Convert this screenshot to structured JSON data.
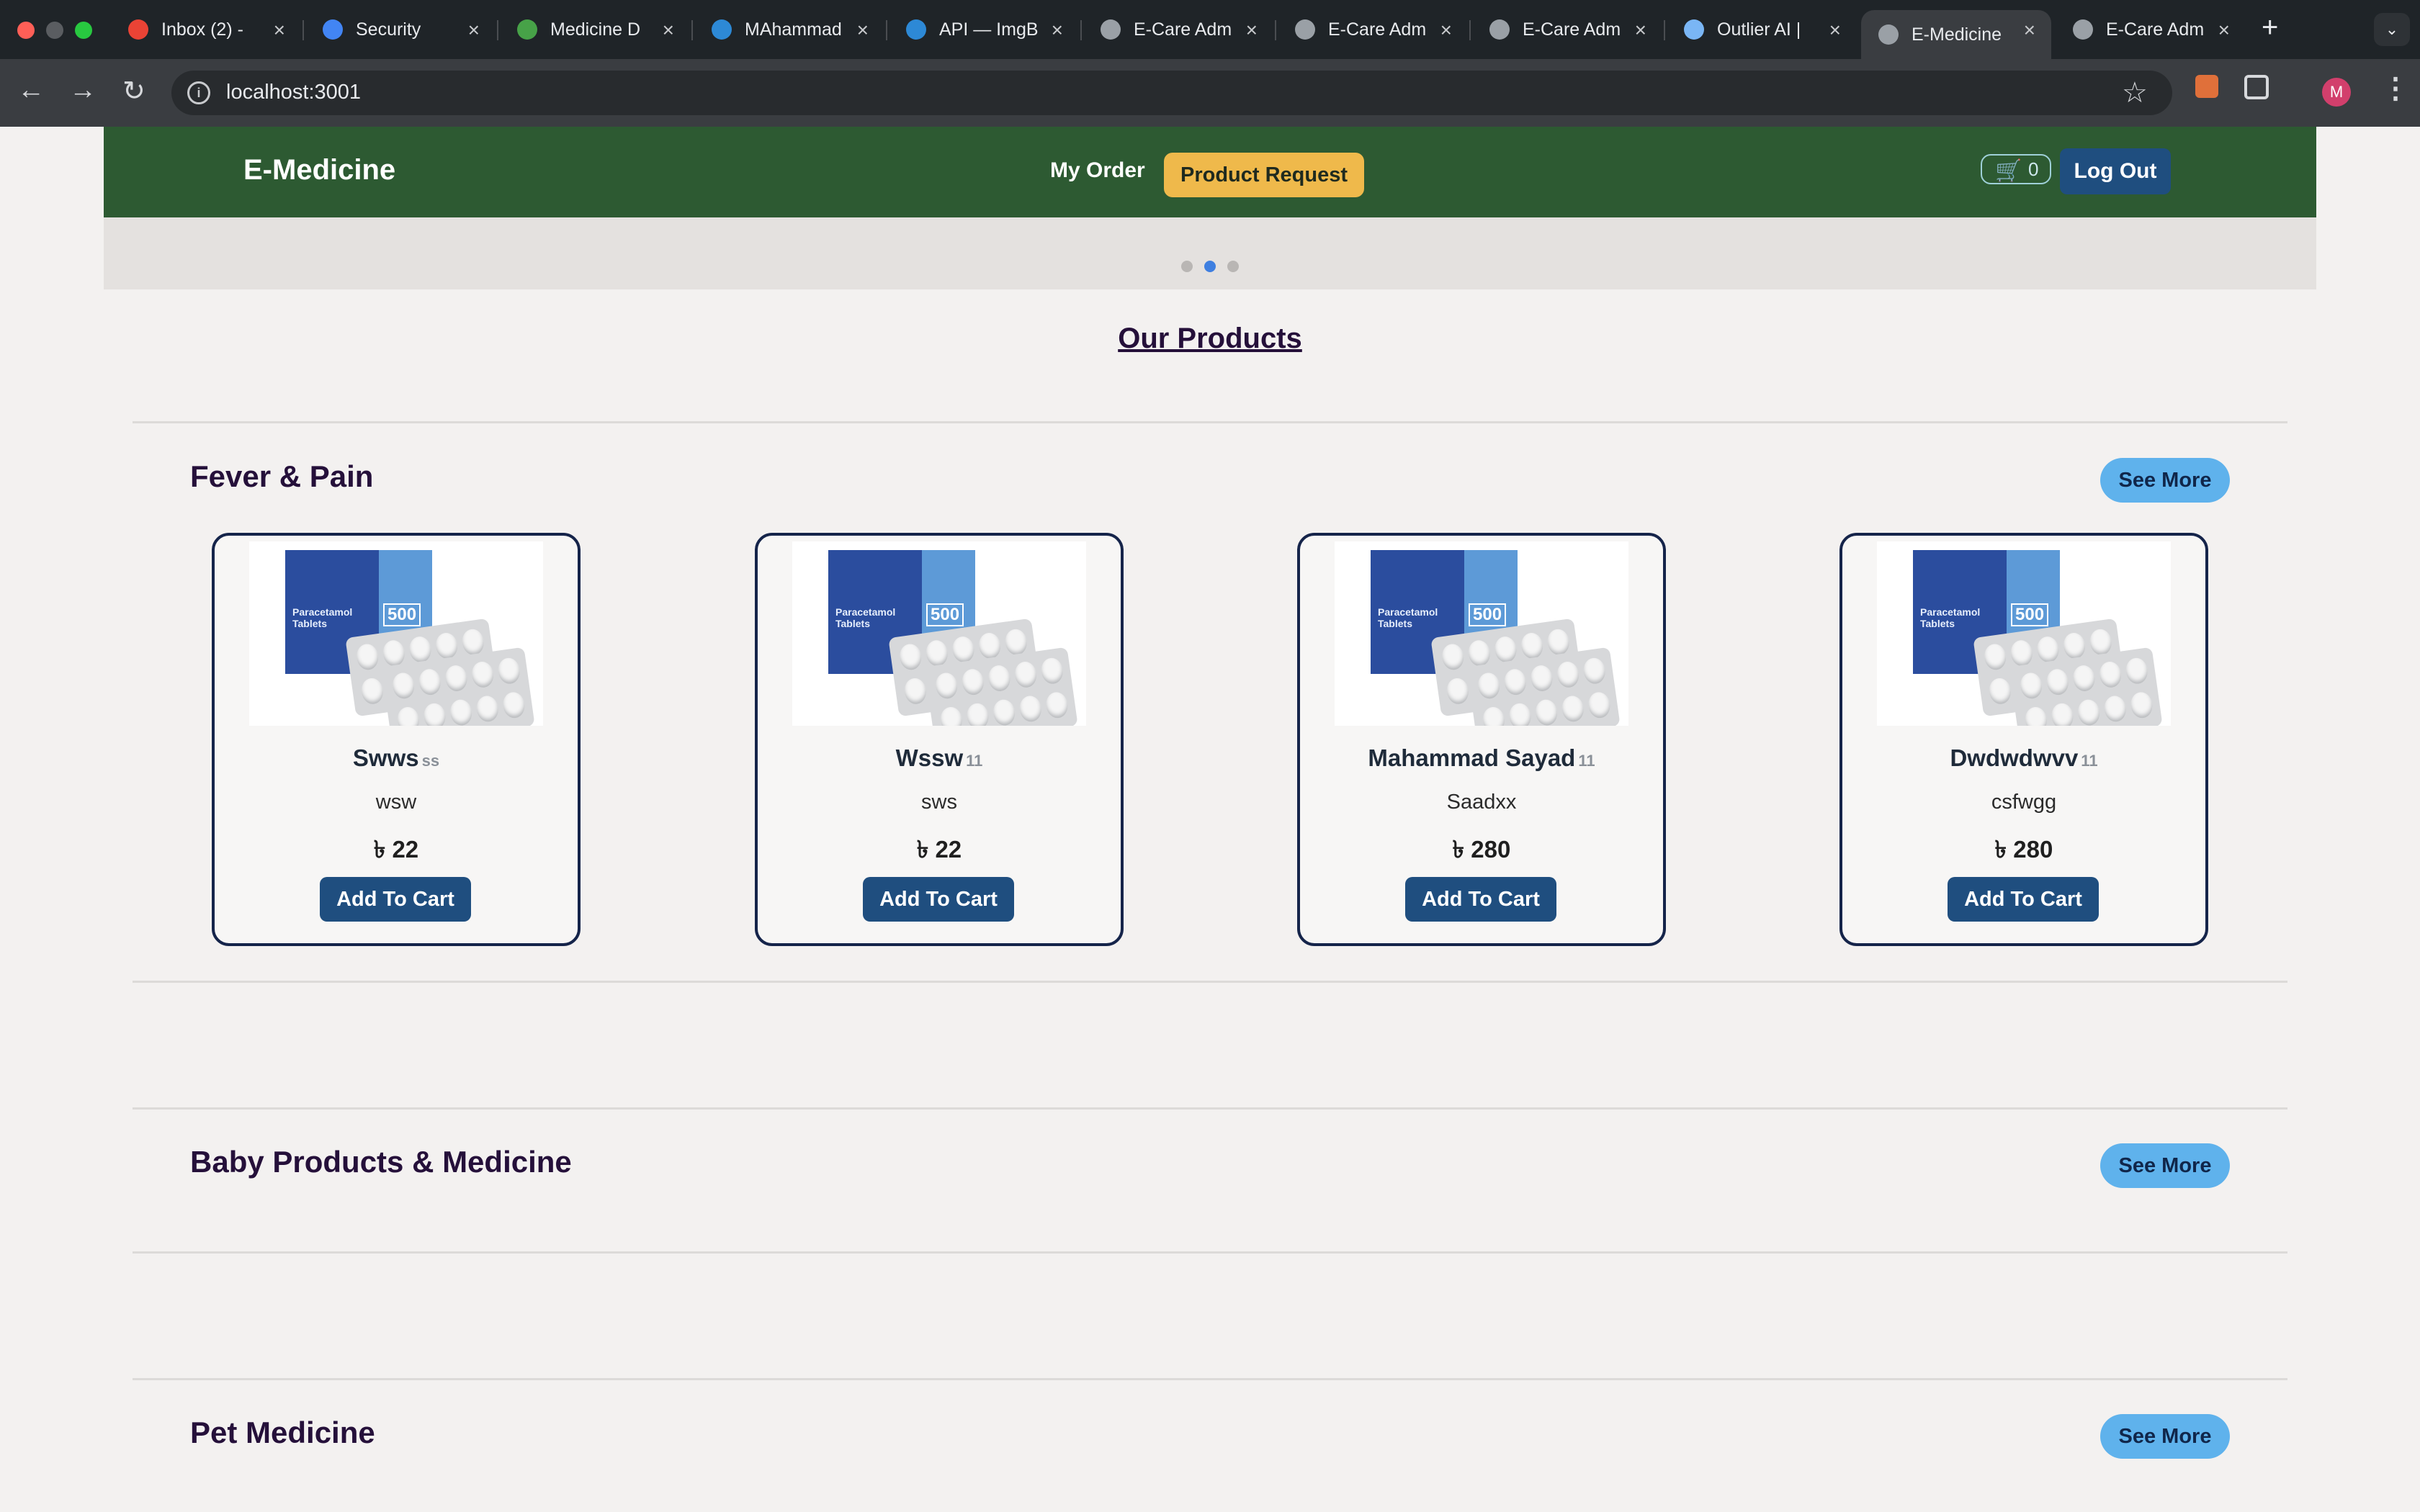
{
  "browser": {
    "tabs": [
      {
        "title": "Inbox (2) - ",
        "favicon": "gmail-icon",
        "color": "#ea4335"
      },
      {
        "title": "Security",
        "favicon": "google-icon",
        "color": "#4285f4"
      },
      {
        "title": "Medicine D",
        "favicon": "mongodb-icon",
        "color": "#47a248"
      },
      {
        "title": "MAhammad",
        "favicon": "imgbb-icon",
        "color": "#2d89d6"
      },
      {
        "title": "API — ImgB",
        "favicon": "imgbb-icon",
        "color": "#2d89d6"
      },
      {
        "title": "E-Care Adm",
        "favicon": "globe-icon",
        "color": "#9aa0a6"
      },
      {
        "title": "E-Care Adm",
        "favicon": "globe-icon",
        "color": "#9aa0a6"
      },
      {
        "title": "E-Care Adm",
        "favicon": "globe-icon",
        "color": "#9aa0a6"
      },
      {
        "title": "Outlier AI |",
        "favicon": "outlier-icon",
        "color": "#7ab6f5"
      },
      {
        "title": "E-Medicine",
        "favicon": "globe-icon",
        "color": "#9aa0a6",
        "active": true
      },
      {
        "title": "E-Care Adm",
        "favicon": "globe-icon",
        "color": "#9aa0a6"
      }
    ],
    "url": "localhost:3001",
    "avatar_letter": "M"
  },
  "navbar": {
    "brand": "E-Medicine",
    "my_order": "My Order",
    "product_request": "Product Request",
    "cart_count": "0",
    "logout": "Log Out"
  },
  "carousel": {
    "slides": 3,
    "active": 1
  },
  "main": {
    "heading": "Our Products",
    "categories": [
      {
        "title": "Fever & Pain",
        "see_more": "See More",
        "products": [
          {
            "name": "Swws",
            "qty": "ss",
            "desc": "wsw",
            "price": "৳ 22",
            "button": "Add To Cart"
          },
          {
            "name": "Wssw",
            "qty": "11",
            "desc": "sws",
            "price": "৳ 22",
            "button": "Add To Cart"
          },
          {
            "name": "Mahammad Sayad",
            "qty": "11",
            "desc": "Saadxx",
            "price": "৳ 280",
            "button": "Add To Cart"
          },
          {
            "name": "Dwdwdwvv",
            "qty": "11",
            "desc": "csfwgg",
            "price": "৳ 280",
            "button": "Add To Cart"
          }
        ]
      },
      {
        "title": "Baby Products & Medicine",
        "see_more": "See More",
        "products": []
      },
      {
        "title": "Pet Medicine",
        "see_more": "See More",
        "products": []
      }
    ],
    "product_image_labels": {
      "brand": "Paracetamol Tablets",
      "strength": "500"
    }
  },
  "colors": {
    "navbar_bg": "#2d5a32",
    "accent_yellow": "#efb94b",
    "button_blue": "#1f4e7f",
    "see_more_blue": "#5fb2ec"
  }
}
